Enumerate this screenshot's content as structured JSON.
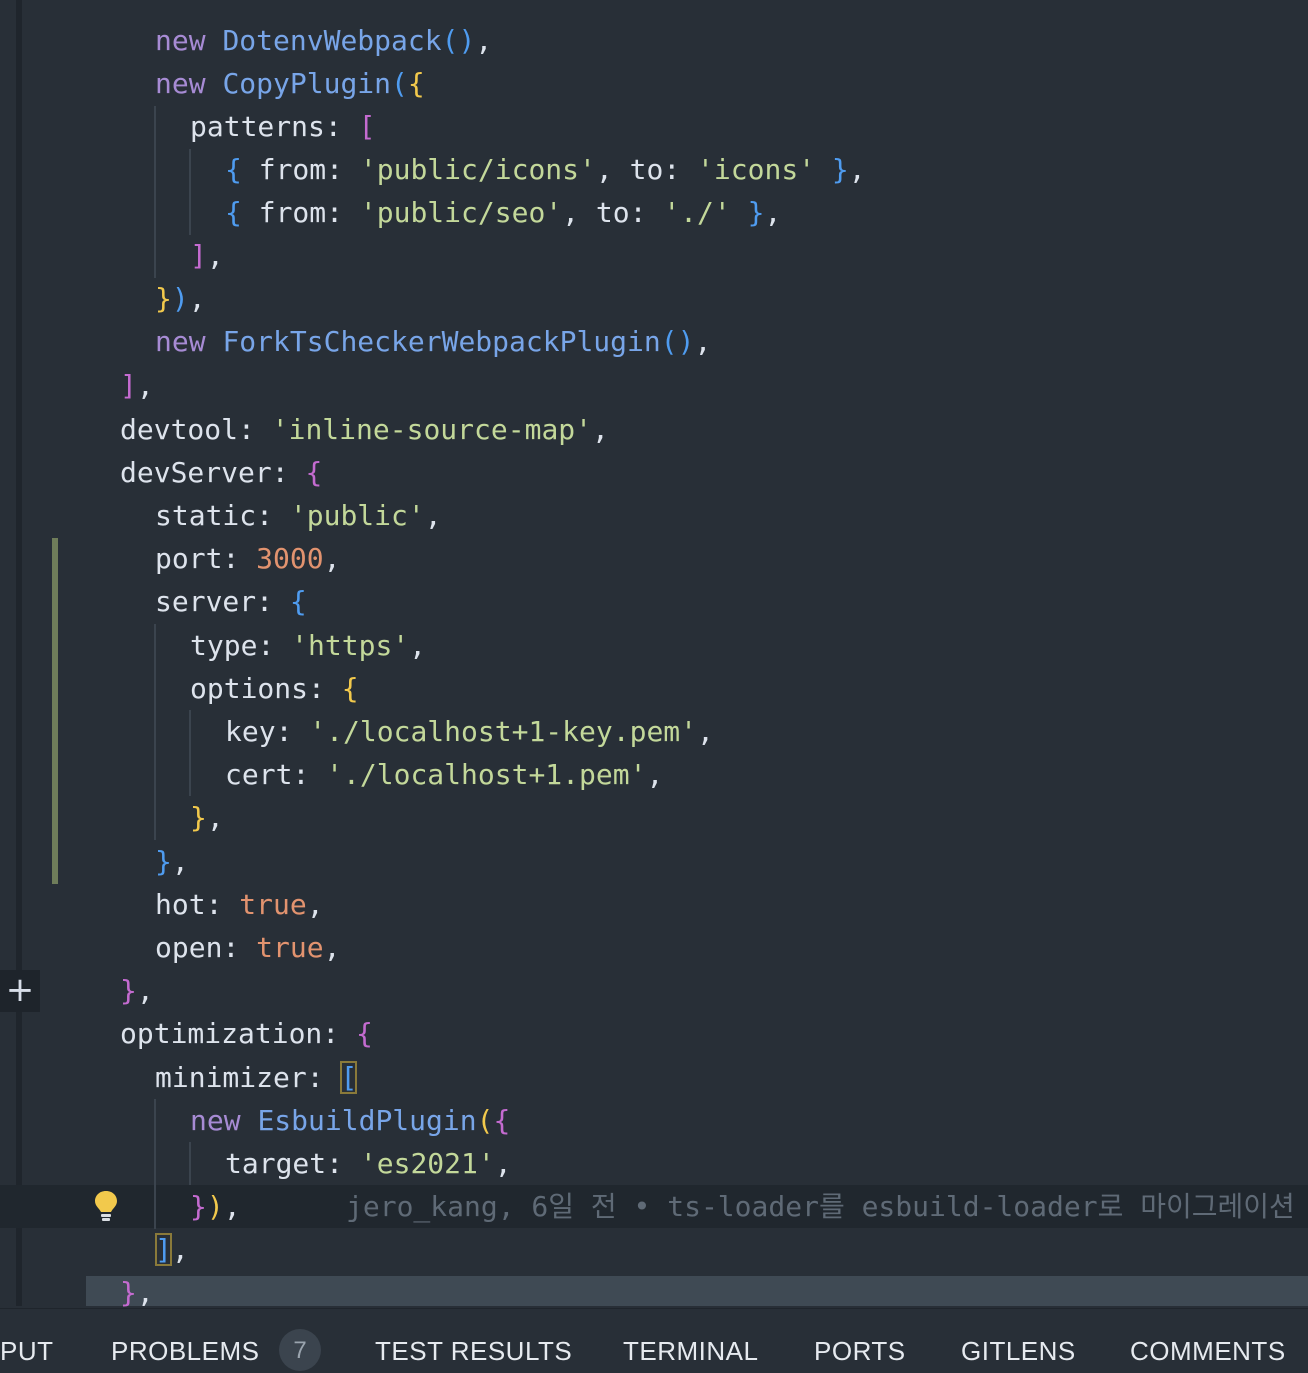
{
  "code": {
    "l1": {
      "kw": "new",
      "cls": "DotenvWebpack",
      "p1": "(",
      "p2": ")",
      "tail": ","
    },
    "l2": {
      "kw": "new",
      "cls": "CopyPlugin",
      "p1": "(",
      "p2": "{"
    },
    "l3": {
      "prop": "patterns",
      "colon": ": ",
      "br": "["
    },
    "l4": {
      "o": "{",
      "k1": " from",
      "c1": ": ",
      "v1": "'public/icons'",
      "sep": ", ",
      "k2": "to",
      "c2": ": ",
      "v2": "'icons'",
      "cl": " }",
      "tail": ","
    },
    "l5": {
      "o": "{",
      "k1": " from",
      "c1": ": ",
      "v1": "'public/seo'",
      "sep": ", ",
      "k2": "to",
      "c2": ": ",
      "v2": "'./'",
      "cl": " }",
      "tail": ","
    },
    "l6": {
      "br": "]",
      "tail": ","
    },
    "l7": {
      "b1": "}",
      "b2": ")",
      "tail": ","
    },
    "l8": {
      "kw": "new",
      "cls": "ForkTsCheckerWebpackPlugin",
      "p1": "(",
      "p2": ")",
      "tail": ","
    },
    "l9": {
      "br": "]",
      "tail": ","
    },
    "l10": {
      "prop": "devtool",
      "colon": ": ",
      "str": "'inline-source-map'",
      "tail": ","
    },
    "l11": {
      "prop": "devServer",
      "colon": ": ",
      "br": "{"
    },
    "l12": {
      "prop": "static",
      "colon": ": ",
      "str": "'public'",
      "tail": ","
    },
    "l13": {
      "prop": "port",
      "colon": ": ",
      "num": "3000",
      "tail": ","
    },
    "l14": {
      "prop": "server",
      "colon": ": ",
      "br": "{"
    },
    "l15": {
      "prop": "type",
      "colon": ": ",
      "str": "'https'",
      "tail": ","
    },
    "l16": {
      "prop": "options",
      "colon": ": ",
      "br": "{"
    },
    "l17": {
      "prop": "key",
      "colon": ": ",
      "str": "'./localhost+1-key.pem'",
      "tail": ","
    },
    "l18": {
      "prop": "cert",
      "colon": ": ",
      "str": "'./localhost+1.pem'",
      "tail": ","
    },
    "l19": {
      "br": "}",
      "tail": ","
    },
    "l20": {
      "br": "}",
      "tail": ","
    },
    "l21": {
      "prop": "hot",
      "colon": ": ",
      "val": "true",
      "tail": ","
    },
    "l22": {
      "prop": "open",
      "colon": ": ",
      "val": "true",
      "tail": ","
    },
    "l23": {
      "br": "}",
      "tail": ","
    },
    "l24": {
      "prop": "optimization",
      "colon": ": ",
      "br": "{"
    },
    "l25": {
      "prop": "minimizer",
      "colon": ": ",
      "br": "["
    },
    "l26": {
      "kw": "new",
      "cls": "EsbuildPlugin",
      "p1": "(",
      "p2": "{"
    },
    "l27": {
      "prop": "target",
      "colon": ": ",
      "str": "'es2021'",
      "tail": ","
    },
    "l28": {
      "b1": "}",
      "b2": ")",
      "tail": ","
    },
    "l29": {
      "br": "]",
      "tail": ","
    },
    "l30": {
      "br": "}",
      "tail": ","
    }
  },
  "blame": "jero_kang, 6일 전 • ts-loader를 esbuild-loader로 마이그레이션",
  "panel": {
    "tabs": [
      "PUT",
      "PROBLEMS",
      "TEST RESULTS",
      "TERMINAL",
      "PORTS",
      "GITLENS",
      "COMMENTS"
    ],
    "problems_count": "7"
  },
  "colors": {
    "background": "#282f37",
    "keyword": "#a78bd4",
    "class": "#78a5e8",
    "string": "#c3d89a",
    "number": "#e2936f",
    "bracket_yellow": "#f2c94c",
    "bracket_magenta": "#c46bd0",
    "bracket_blue": "#4f9cf0",
    "gutter_modified": "#6f7d5a"
  },
  "icons": [
    "add-line-icon",
    "lightbulb-icon"
  ]
}
